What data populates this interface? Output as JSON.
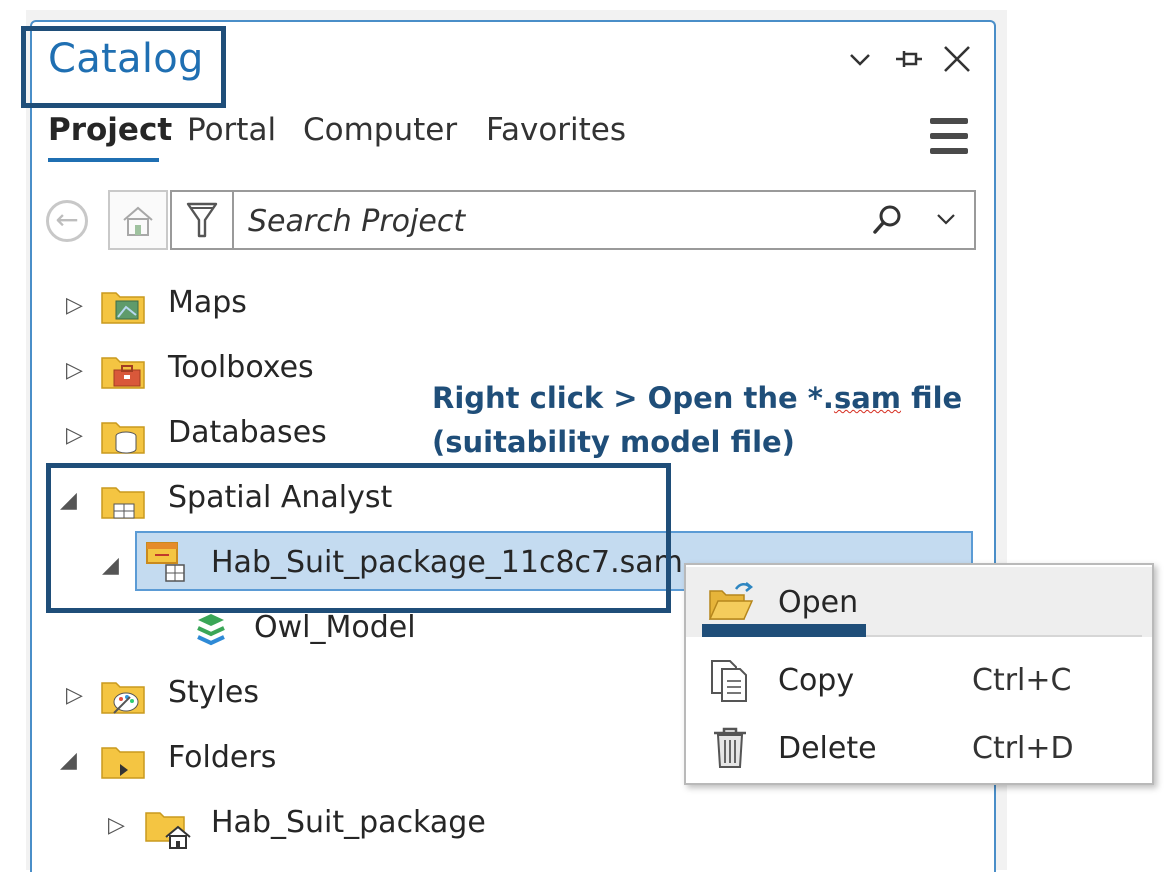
{
  "panel": {
    "title": "Catalog",
    "window_buttons": {
      "options": "⌵",
      "pin": "⊣",
      "close": "✕"
    }
  },
  "tabs": [
    {
      "label": "Project",
      "active": true
    },
    {
      "label": "Portal",
      "active": false
    },
    {
      "label": "Computer",
      "active": false
    },
    {
      "label": "Favorites",
      "active": false
    }
  ],
  "toolbar": {
    "back_label": "←",
    "search_placeholder": "Search Project"
  },
  "tree": {
    "maps": "Maps",
    "toolboxes": "Toolboxes",
    "databases": "Databases",
    "spatial_analyst": "Spatial Analyst",
    "sam_file": "Hab_Suit_package_11c8c7.sam",
    "owl_model": "Owl_Model",
    "styles": "Styles",
    "folders": "Folders",
    "hab_suit_package": "Hab_Suit_package"
  },
  "annotation": {
    "line1_prefix": "Right click > Open the *.",
    "line1_squiggle": "sam",
    "line1_suffix": " file",
    "line2": "(suitability model file)"
  },
  "context_menu": {
    "items": [
      {
        "label": "Open",
        "shortcut": ""
      },
      {
        "label": "Copy",
        "shortcut": "Ctrl+C"
      },
      {
        "label": "Delete",
        "shortcut": "Ctrl+D"
      }
    ]
  },
  "colors": {
    "accent_blue": "#1f6fb2",
    "callout_navy": "#1f4e79",
    "selection": "#c4dbf0",
    "folder_yellow": "#f4c542"
  }
}
